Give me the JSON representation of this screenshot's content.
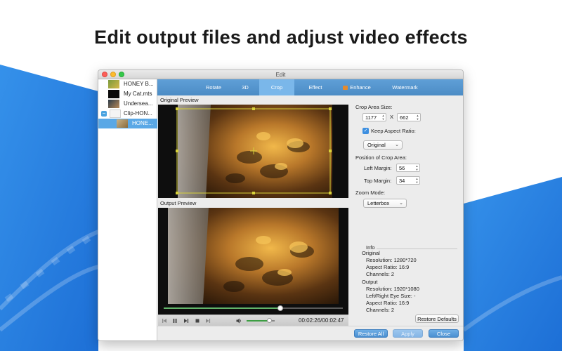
{
  "headline": "Edit output files and adjust video effects",
  "window": {
    "title": "Edit"
  },
  "files": [
    {
      "name": "HONEY B..."
    },
    {
      "name": "My Cat.mts"
    },
    {
      "name": "Undersea..."
    },
    {
      "name": "Clip-HON..."
    },
    {
      "name": "HONE..."
    }
  ],
  "tabs": [
    "Rotate",
    "3D",
    "Crop",
    "Effect",
    "Enhance",
    "Watermark"
  ],
  "active_tab": "Crop",
  "previews": {
    "original_label": "Original Preview",
    "output_label": "Output Preview"
  },
  "player": {
    "time": "00:02:26/00:02:47",
    "progress": 0.65,
    "volume": 0.8
  },
  "crop": {
    "area_size_label": "Crop Area Size:",
    "width": "1177",
    "x_label": "X",
    "height": "662",
    "keep_aspect_label": "Keep Aspect Ratio:",
    "keep_aspect_checked": true,
    "aspect_value": "Original",
    "position_label": "Position of Crop Area:",
    "left_margin_label": "Left Margin:",
    "left_margin": "56",
    "top_margin_label": "Top Margin:",
    "top_margin": "34",
    "zoom_label": "Zoom Mode:",
    "zoom_value": "Letterbox"
  },
  "info": {
    "title": "Info",
    "original_title": "Original",
    "original_resolution": "Resolution: 1280*720",
    "original_aspect": "Aspect Ratio: 16:9",
    "original_channels": "Channels: 2",
    "output_title": "Output",
    "output_resolution": "Resolution: 1920*1080",
    "output_eye": "Left/Right Eye Size: -",
    "output_aspect": "Aspect Ratio: 16:9",
    "output_channels": "Channels: 2"
  },
  "buttons": {
    "restore_defaults": "Restore Defaults",
    "restore_all": "Restore All",
    "apply": "Apply",
    "close": "Close"
  },
  "colors": {
    "accent": "#4c8cc5",
    "background_blue": "#2b7fde"
  }
}
